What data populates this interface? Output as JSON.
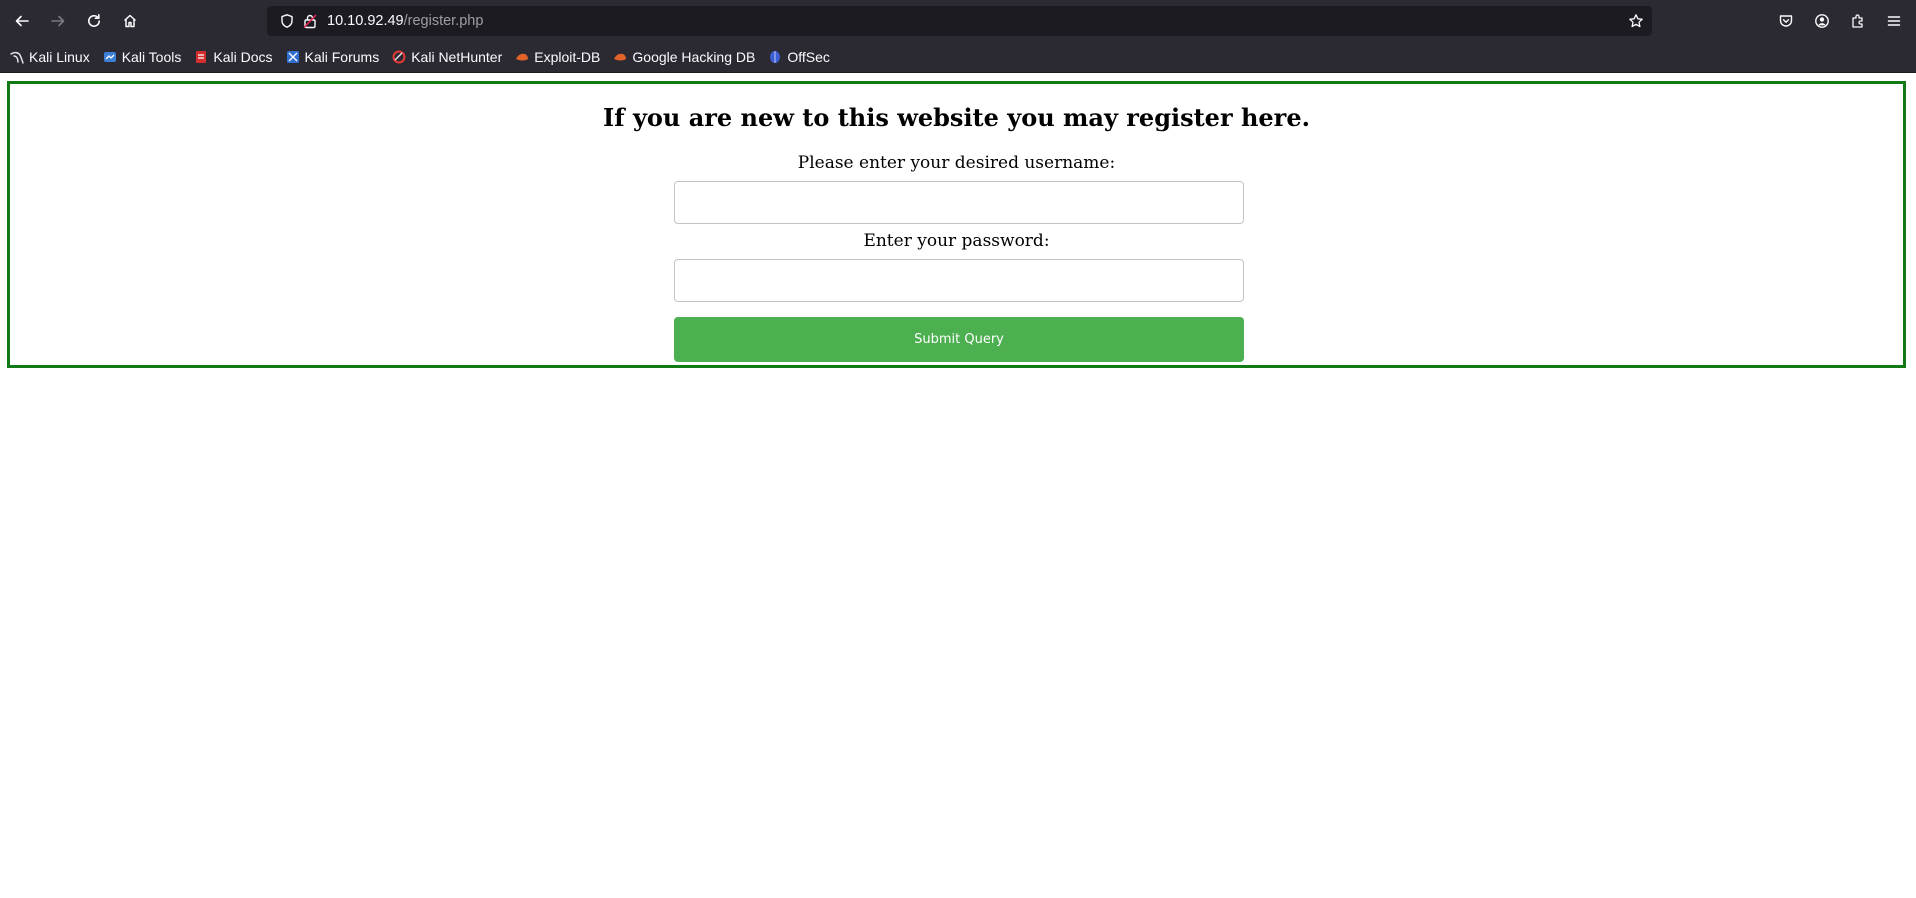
{
  "browser": {
    "url_host": "10.10.92.49",
    "url_path": "/register.php",
    "bookmarks": [
      {
        "label": "Kali Linux",
        "icon": "kali-dragon-icon"
      },
      {
        "label": "Kali Tools",
        "icon": "kali-tools-icon"
      },
      {
        "label": "Kali Docs",
        "icon": "kali-docs-icon"
      },
      {
        "label": "Kali Forums",
        "icon": "kali-forums-icon"
      },
      {
        "label": "Kali NetHunter",
        "icon": "kali-nethunter-icon"
      },
      {
        "label": "Exploit-DB",
        "icon": "exploit-db-icon"
      },
      {
        "label": "Google Hacking DB",
        "icon": "google-hacking-db-icon"
      },
      {
        "label": "OffSec",
        "icon": "offsec-icon"
      }
    ]
  },
  "page": {
    "heading": "If you are new to this website you may register here.",
    "username_label": "Please enter your desired username:",
    "username_value": "",
    "password_label": "Enter your password:",
    "password_value": "",
    "submit_label": "Submit Query"
  },
  "colors": {
    "form_border": "#117a17",
    "submit_bg": "#4caf50",
    "chrome_bg": "#2b2a33",
    "urlbar_bg": "#1c1b22"
  }
}
